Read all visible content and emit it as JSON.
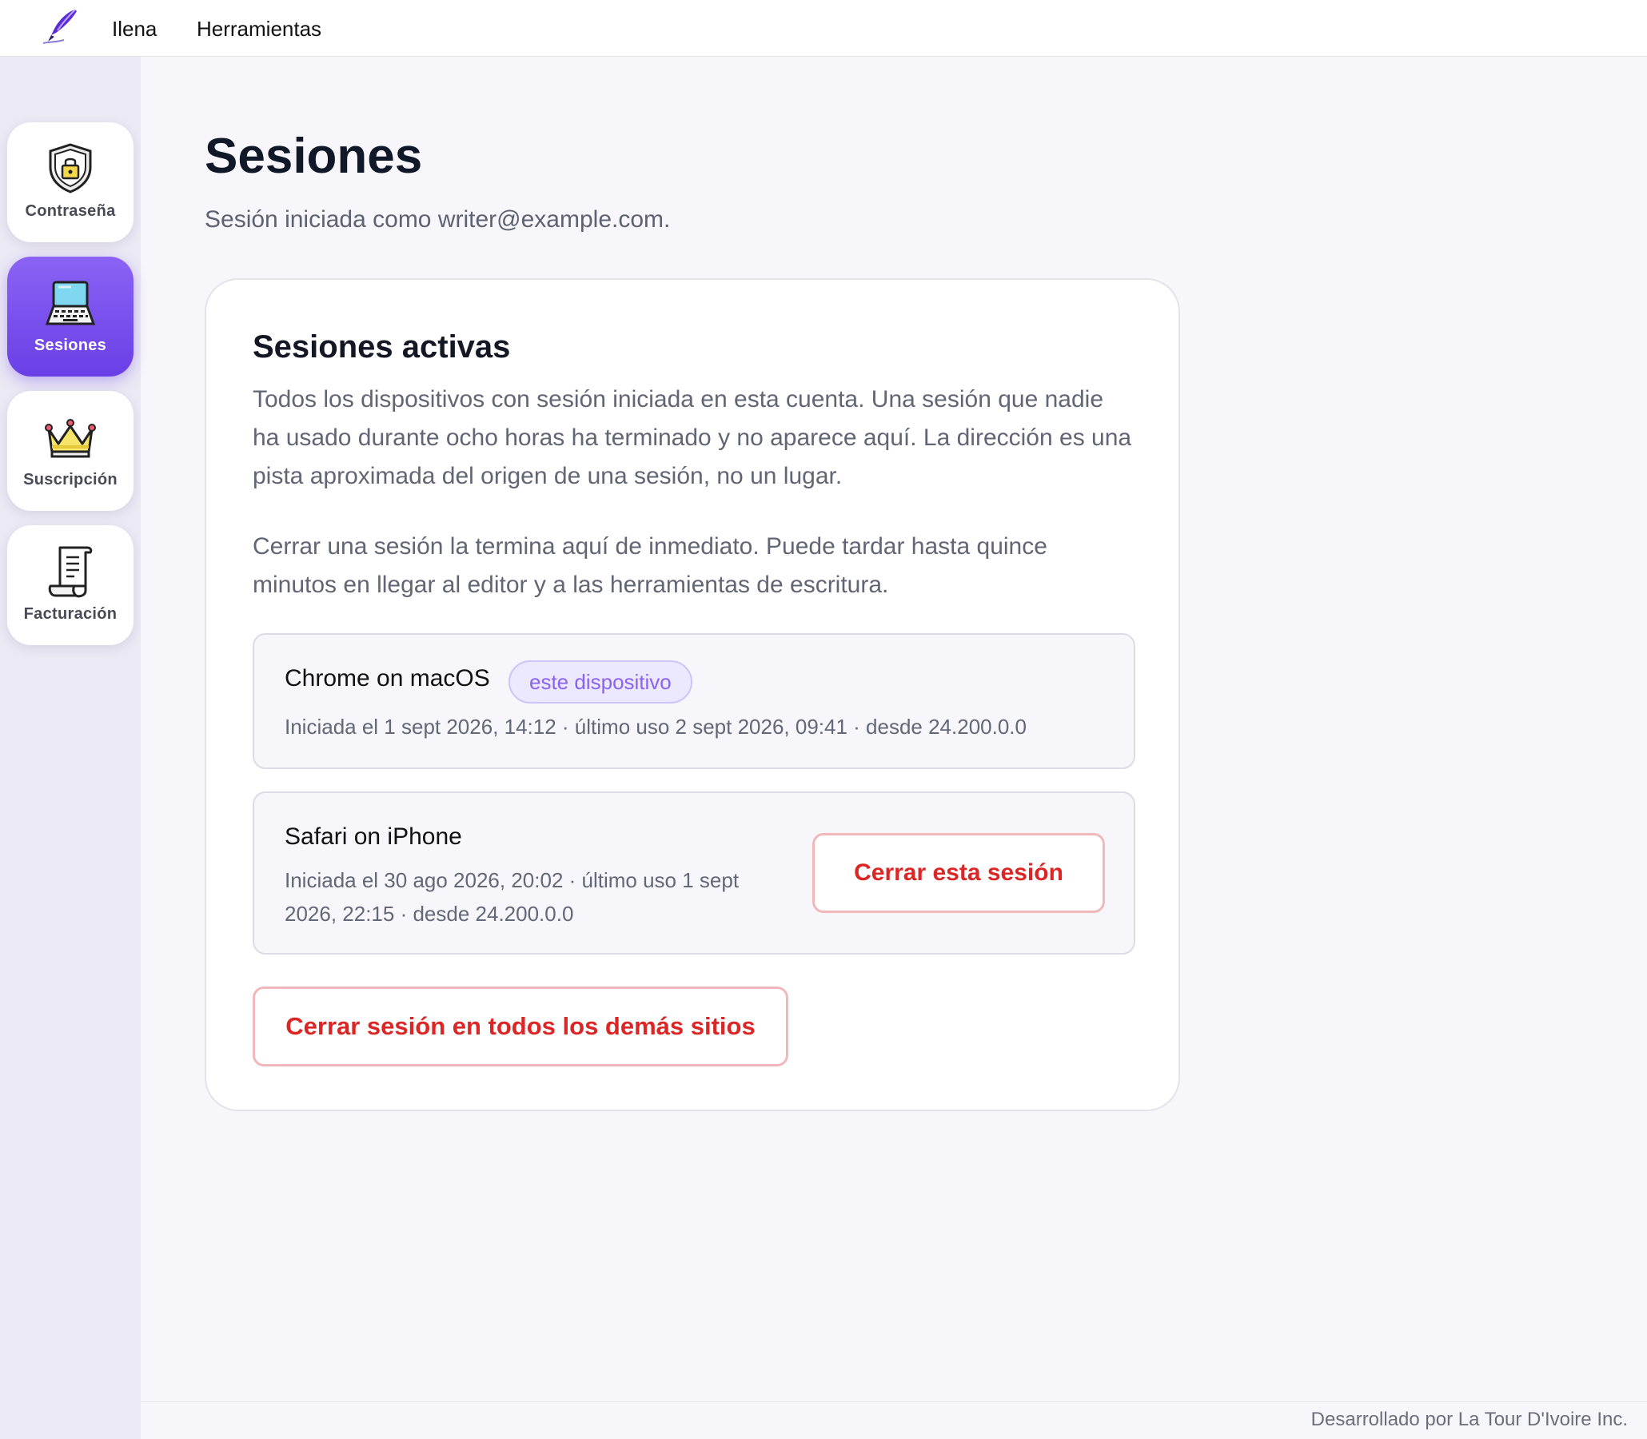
{
  "topbar": {
    "logo_icon": "quill-pen-icon",
    "user_link": "Ilena",
    "tools_link": "Herramientas"
  },
  "sidebar": {
    "items": [
      {
        "label": "Contraseña",
        "icon": "shield-lock-icon",
        "active": false
      },
      {
        "label": "Sesiones",
        "icon": "laptop-icon",
        "active": true
      },
      {
        "label": "Suscripción",
        "icon": "crown-icon",
        "active": false
      },
      {
        "label": "Facturación",
        "icon": "receipt-scroll-icon",
        "active": false
      }
    ]
  },
  "main": {
    "title": "Sesiones",
    "subtitle": "Sesión iniciada como writer@example.com."
  },
  "card": {
    "title": "Sesiones activas",
    "paragraph1": "Todos los dispositivos con sesión iniciada en esta cuenta. Una sesión que nadie ha usado durante ocho horas ha terminado y no aparece aquí. La dirección es una pista aproximada del origen de una sesión, no un lugar.",
    "paragraph2": "Cerrar una sesión la termina aquí de inmediato. Puede tardar hasta quince minutos en llegar al editor y a las herramientas de escritura.",
    "sessions": [
      {
        "name": "Chrome on macOS",
        "badge": "este dispositivo",
        "meta": "Iniciada el 1 sept 2026, 14:12 · último uso 2 sept 2026, 09:41 · desde 24.200.0.0"
      },
      {
        "name": "Safari on iPhone",
        "meta": "Iniciada el 30 ago 2026, 20:02 · último uso 1 sept 2026, 22:15 · desde 24.200.0.0",
        "button": "Cerrar esta sesión"
      }
    ],
    "close_all_button": "Cerrar sesión en todos los demás sitios"
  },
  "footer": {
    "text": "Desarrollado por La Tour D'Ivoire Inc."
  },
  "colors": {
    "accent": "#6a3fe6",
    "danger": "#dc2626",
    "badge_bg": "#ece8fd"
  }
}
